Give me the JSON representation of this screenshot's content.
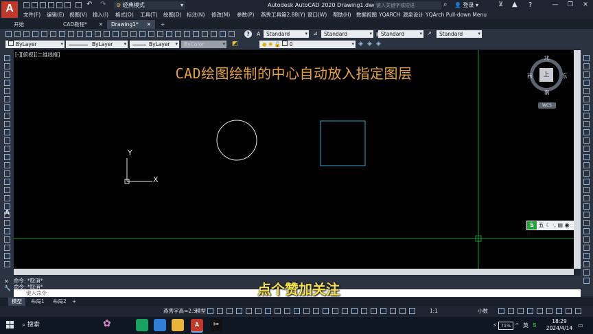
{
  "titlebar": {
    "app_logo": "A",
    "workspace": "经典模式",
    "window_title": "Autodesk AutoCAD 2020    Drawing1.dwg",
    "search_placeholder": "键入关键字或短语",
    "login": "登录",
    "help": "?"
  },
  "menubar": {
    "items": [
      "文件(F)",
      "编辑(E)",
      "视图(V)",
      "插入(I)",
      "格式(O)",
      "工具(T)",
      "绘图(D)",
      "标注(N)",
      "修改(M)",
      "参数(P)",
      "燕秀工具箱2.88(Y)",
      "窗口(W)",
      "帮助(H)",
      "数据视图",
      "YQARCH",
      "源泉设计",
      "YQArch Pull-down Menu"
    ]
  },
  "doc_tabs": {
    "items": [
      {
        "label": "开始"
      },
      {
        "label": "CAD教程*"
      },
      {
        "label": "Drawing1*"
      }
    ],
    "add": "+"
  },
  "styles": {
    "text_style": "Standard",
    "dim_style": "Standard",
    "table_style": "Standard",
    "mleader_style": "Standard"
  },
  "properties": {
    "layer_color": "ByLayer",
    "linetype": "ByLayer",
    "lineweight": "ByLayer",
    "plot_style": "ByColor",
    "current_layer": "0"
  },
  "canvas": {
    "view_label": "[-][俯视][二维线框]",
    "heading": "CAD绘图绘制的中心自动放入指定图层",
    "ucs_x": "X",
    "ucs_y": "Y"
  },
  "viewcube": {
    "north": "北",
    "south": "南",
    "east": "东",
    "west": "西",
    "face": "上",
    "wcs": "WCS"
  },
  "command": {
    "history": [
      "命令: *取消*",
      "命令: *取消*"
    ],
    "placeholder": "键入命令",
    "overlay_subtitle": "点个赞加关注"
  },
  "layout_tabs": {
    "items": [
      "模型",
      "布局1",
      "布局2"
    ],
    "add": "+"
  },
  "statusbar": {
    "font_height": "燕秀字高=2.5",
    "model": "模型",
    "scale": "1:1",
    "units": "小数"
  },
  "taskbar": {
    "search": "搜索",
    "battery": "71%",
    "ime": "英",
    "time": "18:29",
    "date": "2024/4/14"
  },
  "ime_bar": {
    "mode": "五"
  },
  "colors": {
    "heading": "#e8a33c",
    "subtitle": "#f4e04d",
    "crosshair": "#2bbf3b",
    "square": "#2aa7d6",
    "canvas_bg": "#000000"
  }
}
